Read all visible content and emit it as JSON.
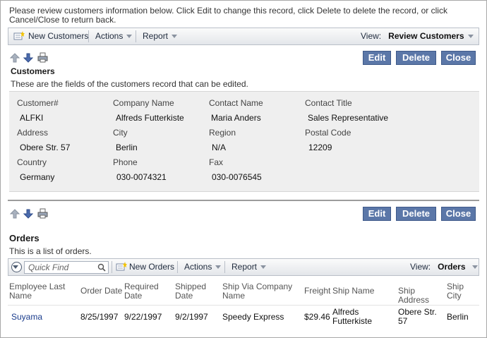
{
  "instructions": "Please review customers information below. Click Edit to change this record, click Delete to delete the record, or click Cancel/Close to return back.",
  "top_toolbar": {
    "new_label": "New Customers",
    "actions_label": "Actions",
    "report_label": "Report",
    "view_prefix": "View:",
    "view_value": "Review Customers"
  },
  "buttons": {
    "edit": "Edit",
    "delete": "Delete",
    "close": "Close"
  },
  "customers": {
    "title": "Customers",
    "description": "These are the fields of the customers record that can be edited.",
    "fields": [
      {
        "label": "Customer#",
        "value": "ALFKI"
      },
      {
        "label": "Company Name",
        "value": "Alfreds Futterkiste"
      },
      {
        "label": "Contact Name",
        "value": "Maria Anders"
      },
      {
        "label": "Contact Title",
        "value": "Sales Representative"
      },
      {
        "label": "Address",
        "value": "Obere Str. 57"
      },
      {
        "label": "City",
        "value": "Berlin"
      },
      {
        "label": "Region",
        "value": "N/A"
      },
      {
        "label": "Postal Code",
        "value": "12209"
      },
      {
        "label": "Country",
        "value": "Germany"
      },
      {
        "label": "Phone",
        "value": "030-0074321"
      },
      {
        "label": "Fax",
        "value": "030-0076545"
      }
    ]
  },
  "orders": {
    "title": "Orders",
    "description": "This is a list of orders.",
    "toolbar": {
      "quick_find_placeholder": "Quick Find",
      "new_label": "New Orders",
      "actions_label": "Actions",
      "report_label": "Report",
      "view_prefix": "View:",
      "view_value": "Orders"
    },
    "columns": [
      "Employee Last Name",
      "Order Date",
      "Required Date",
      "Shipped Date",
      "Ship Via Company Name",
      "Freight",
      "Ship Name",
      "Ship Address",
      "Ship City"
    ],
    "rows": [
      [
        "Suyama",
        "8/25/1997",
        "9/22/1997",
        "9/2/1997",
        "Speedy Express",
        "$29.46",
        "Alfreds Futterkiste",
        "Obere Str. 57",
        "Berlin"
      ]
    ]
  },
  "icons": [
    "up-arrow-icon",
    "down-arrow-icon",
    "print-icon",
    "new-record-icon",
    "search-icon",
    "chevron-down-icon"
  ],
  "colors": {
    "button_bg": "#5b77a8",
    "link": "#1a3c8c",
    "panel_bg": "#efefef"
  }
}
